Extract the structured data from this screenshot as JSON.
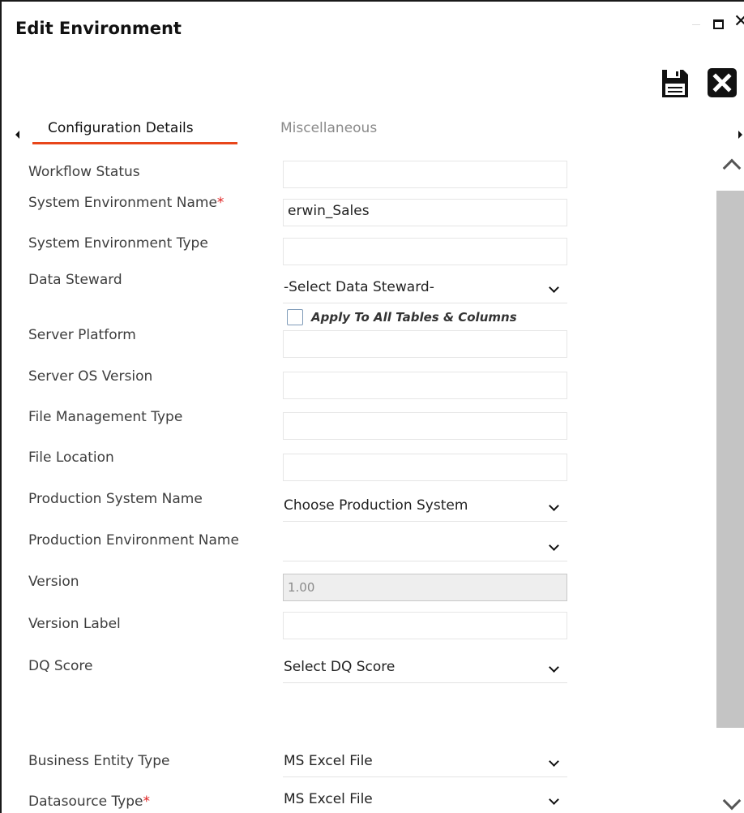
{
  "window": {
    "title": "Edit Environment",
    "close_glyph": "✕"
  },
  "toolbar": {
    "save_icon": "save-icon",
    "cancel_icon": "close-icon"
  },
  "tabs": [
    {
      "label": "Configuration Details",
      "active": true
    },
    {
      "label": "Miscellaneous",
      "active": false
    }
  ],
  "accent_color": "#e8461a",
  "form": {
    "workflow_status": {
      "label": "Workflow Status",
      "value": ""
    },
    "system_environment_name": {
      "label": "System Environment Name",
      "required_mark": "*",
      "value": "erwin_Sales"
    },
    "system_environment_type": {
      "label": "System Environment Type",
      "value": ""
    },
    "data_steward": {
      "label": "Data Steward",
      "value": "-Select Data Steward-"
    },
    "apply_to_all": {
      "label": "Apply To All Tables & Columns",
      "checked": false
    },
    "server_platform": {
      "label": "Server Platform",
      "value": ""
    },
    "server_os_version": {
      "label": "Server OS Version",
      "value": ""
    },
    "file_management_type": {
      "label": "File Management Type",
      "value": ""
    },
    "file_location": {
      "label": "File Location",
      "value": ""
    },
    "production_system_name": {
      "label": "Production System Name",
      "value": "Choose Production System"
    },
    "production_environment_name": {
      "label": "Production Environment Name",
      "value": ""
    },
    "version": {
      "label": "Version",
      "value": "1.00"
    },
    "version_label": {
      "label": "Version Label",
      "value": ""
    },
    "dq_score": {
      "label": "DQ Score",
      "value": "Select DQ Score"
    },
    "business_entity_type": {
      "label": "Business Entity Type",
      "value": "MS Excel File"
    },
    "datasource_type": {
      "label": "Datasource Type",
      "required_mark": "*",
      "value": "MS Excel File"
    }
  }
}
